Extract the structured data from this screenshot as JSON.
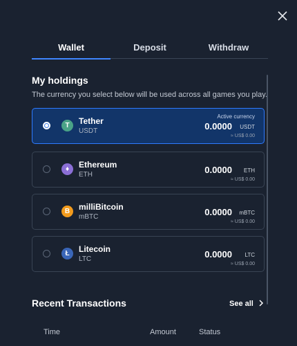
{
  "close_icon": "close-icon",
  "tabs": [
    {
      "label": "Wallet",
      "active": true
    },
    {
      "label": "Deposit",
      "active": false
    },
    {
      "label": "Withdraw",
      "active": false
    }
  ],
  "holdings": {
    "title": "My holdings",
    "subtitle": "The currency you select below will be used across all games you play.",
    "active_label": "Active currency",
    "items": [
      {
        "name": "Tether",
        "code": "USDT",
        "amount": "0.0000",
        "unit": "USDT",
        "usd": "≈ US$ 0.00",
        "icon": "tether-icon",
        "icon_glyph": "T",
        "color": "#4aa387",
        "selected": true
      },
      {
        "name": "Ethereum",
        "code": "ETH",
        "amount": "0.0000",
        "unit": "ETH",
        "usd": "≈ US$ 0.00",
        "icon": "ethereum-icon",
        "icon_glyph": "♦",
        "color": "#8b6fd6",
        "selected": false
      },
      {
        "name": "milliBitcoin",
        "code": "mBTC",
        "amount": "0.0000",
        "unit": "mBTC",
        "usd": "≈ US$ 0.00",
        "icon": "bitcoin-icon",
        "icon_glyph": "B",
        "color": "#f29b1d",
        "selected": false
      },
      {
        "name": "Litecoin",
        "code": "LTC",
        "amount": "0.0000",
        "unit": "LTC",
        "usd": "≈ US$ 0.00",
        "icon": "litecoin-icon",
        "icon_glyph": "Ł",
        "color": "#3a66b8",
        "selected": false
      }
    ]
  },
  "transactions": {
    "title": "Recent Transactions",
    "see_all": "See all",
    "columns": [
      "Time",
      "Amount",
      "Status"
    ]
  },
  "colors": {
    "background": "#1a2230",
    "accent": "#3f86ff",
    "active_card": "#123569"
  }
}
